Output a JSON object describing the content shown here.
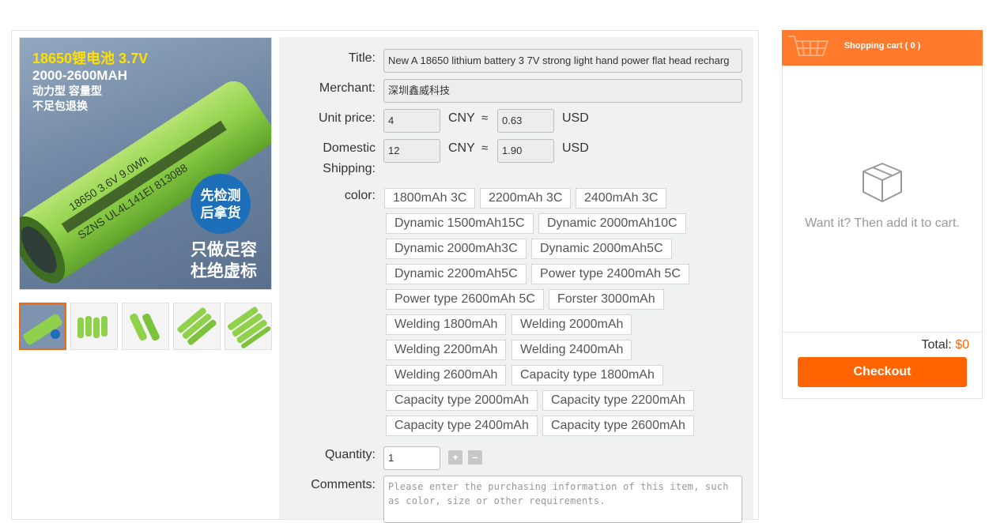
{
  "product_image": {
    "line1": "18650锂电池 3.7V",
    "line2": "2000-2600MAH",
    "line3": "动力型 容量型",
    "line4": "不足包退换",
    "badge_line1": "先检测",
    "badge_line2": "后拿货",
    "promo_line1": "只做足容",
    "promo_line2": "杜绝虚标",
    "cell_print_1": "18650 3.6V 9.0Wh",
    "cell_print_2": "SZNS UL4L141EI 813088"
  },
  "form": {
    "title_label": "Title:",
    "title_value": "New A 18650 lithium battery 3 7V strong light hand power flat head recharg",
    "merchant_label": "Merchant:",
    "merchant_value": "深圳鑫威科技",
    "unit_price_label": "Unit price:",
    "unit_price_cny": "4",
    "unit_price_usd": "0.63",
    "shipping_label_line1": "Domestic",
    "shipping_label_line2": "Shipping:",
    "shipping_cny": "12",
    "shipping_usd": "1.90",
    "cny": "CNY",
    "approx": "≈",
    "usd": "USD",
    "color_label": "color:",
    "color_options": [
      "1800mAh 3C",
      "2200mAh 3C",
      "2400mAh 3C",
      "Dynamic 1500mAh15C",
      "Dynamic 2000mAh10C",
      "Dynamic 2000mAh3C",
      "Dynamic 2000mAh5C",
      "Dynamic 2200mAh5C",
      "Power type 2400mAh 5C",
      "Power type 2600mAh 5C",
      "Forster 3000mAh",
      "Welding 1800mAh",
      "Welding 2000mAh",
      "Welding 2200mAh",
      "Welding 2400mAh",
      "Welding 2600mAh",
      "Capacity type 1800mAh",
      "Capacity type 2000mAh",
      "Capacity type 2200mAh",
      "Capacity type 2400mAh",
      "Capacity type 2600mAh"
    ],
    "quantity_label": "Quantity:",
    "quantity_value": "1",
    "plus": "+",
    "minus": "–",
    "comments_label": "Comments:",
    "comments_placeholder": "Please enter the purchasing information of this item, such as color, size or other requirements."
  },
  "cart": {
    "title": "Shopping cart ( 0 )",
    "empty_text": "Want it? Then add it to cart.",
    "total_label": "Total:",
    "total_value": "$0",
    "checkout_label": "Checkout"
  },
  "colors": {
    "accent": "#ff6400",
    "cart_header": "#ff7a2c",
    "price_highlight": "#f06a12"
  }
}
